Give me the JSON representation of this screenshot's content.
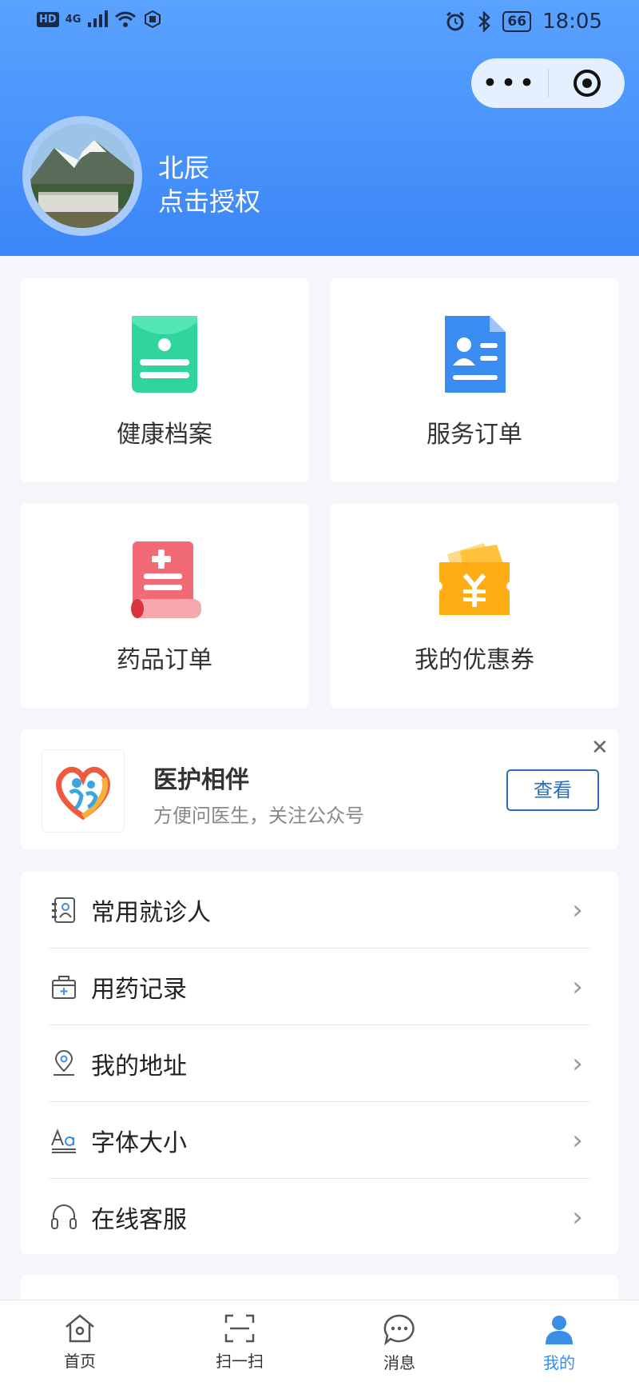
{
  "status_bar": {
    "time": "18:05",
    "battery": "66",
    "network": "4G",
    "hd": "HD"
  },
  "header": {
    "username": "北辰",
    "authorize_text": "点击授权",
    "more_glyph": "•••"
  },
  "grid": [
    {
      "label": "健康档案",
      "icon": "health-record-icon",
      "color": "#2fd59a"
    },
    {
      "label": "服务订单",
      "icon": "service-order-icon",
      "color": "#3b8cf0"
    },
    {
      "label": "药品订单",
      "icon": "medicine-order-icon",
      "color": "#f06b75"
    },
    {
      "label": "我的优惠券",
      "icon": "coupon-icon",
      "color": "#ffad14"
    }
  ],
  "official_account": {
    "title": "医护相伴",
    "subtitle": "方便问医生，关注公众号",
    "button": "查看",
    "close": "✕"
  },
  "menu": [
    {
      "label": "常用就诊人",
      "icon": "patient-contacts-icon"
    },
    {
      "label": "用药记录",
      "icon": "medicine-box-icon"
    },
    {
      "label": "我的地址",
      "icon": "location-pin-icon"
    },
    {
      "label": "字体大小",
      "icon": "font-size-icon"
    },
    {
      "label": "在线客服",
      "icon": "headset-icon"
    }
  ],
  "chevron": "›",
  "tabbar": [
    {
      "label": "首页",
      "icon": "home-icon"
    },
    {
      "label": "扫一扫",
      "icon": "scan-icon"
    },
    {
      "label": "消息",
      "icon": "message-icon"
    },
    {
      "label": "我的",
      "icon": "profile-icon",
      "active": true
    }
  ],
  "colors": {
    "accent": "#3a8ee6",
    "header_top": "#5aa2ff",
    "header_bottom": "#3b86f7"
  }
}
